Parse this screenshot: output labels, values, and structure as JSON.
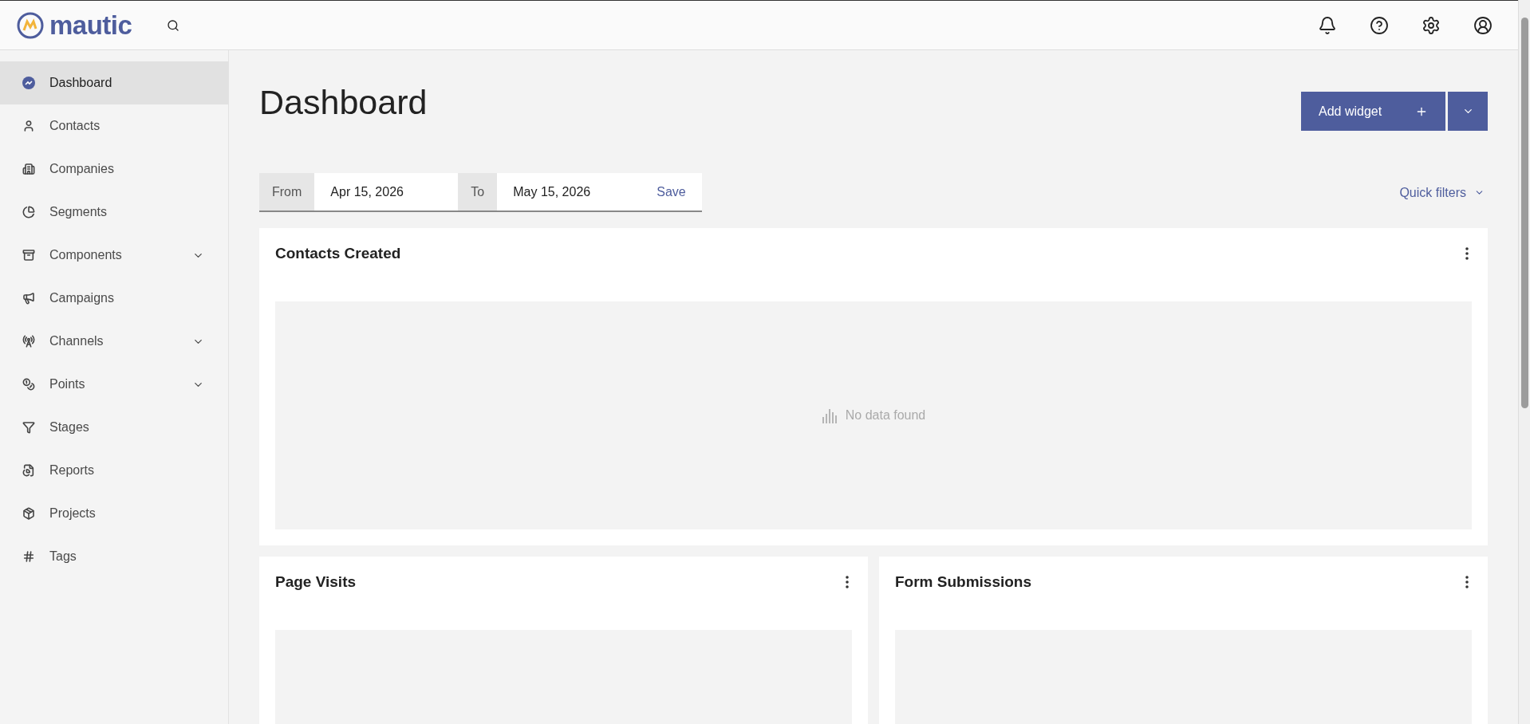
{
  "header": {
    "logo": "mautic"
  },
  "sidebar": {
    "items": [
      {
        "label": "Dashboard",
        "selected": true,
        "has_submenu": false
      },
      {
        "label": "Contacts",
        "selected": false,
        "has_submenu": false
      },
      {
        "label": "Companies",
        "selected": false,
        "has_submenu": false
      },
      {
        "label": "Segments",
        "selected": false,
        "has_submenu": false
      },
      {
        "label": "Components",
        "selected": false,
        "has_submenu": true
      },
      {
        "label": "Campaigns",
        "selected": false,
        "has_submenu": false
      },
      {
        "label": "Channels",
        "selected": false,
        "has_submenu": true
      },
      {
        "label": "Points",
        "selected": false,
        "has_submenu": true
      },
      {
        "label": "Stages",
        "selected": false,
        "has_submenu": false
      },
      {
        "label": "Reports",
        "selected": false,
        "has_submenu": false
      },
      {
        "label": "Projects",
        "selected": false,
        "has_submenu": false
      },
      {
        "label": "Tags",
        "selected": false,
        "has_submenu": false
      }
    ]
  },
  "page": {
    "title": "Dashboard",
    "add_button": "Add widget"
  },
  "filter": {
    "from_label": "From",
    "from_value": "Apr 15, 2026",
    "to_label": "To",
    "to_value": "May 15, 2026",
    "save": "Save",
    "quick_filters": "Quick filters"
  },
  "widgets": [
    {
      "title": "Contacts Created",
      "empty_text": "No data found",
      "wide": true
    },
    {
      "title": "Page Visits",
      "wide": false
    },
    {
      "title": "Form Submissions",
      "wide": false
    }
  ]
}
